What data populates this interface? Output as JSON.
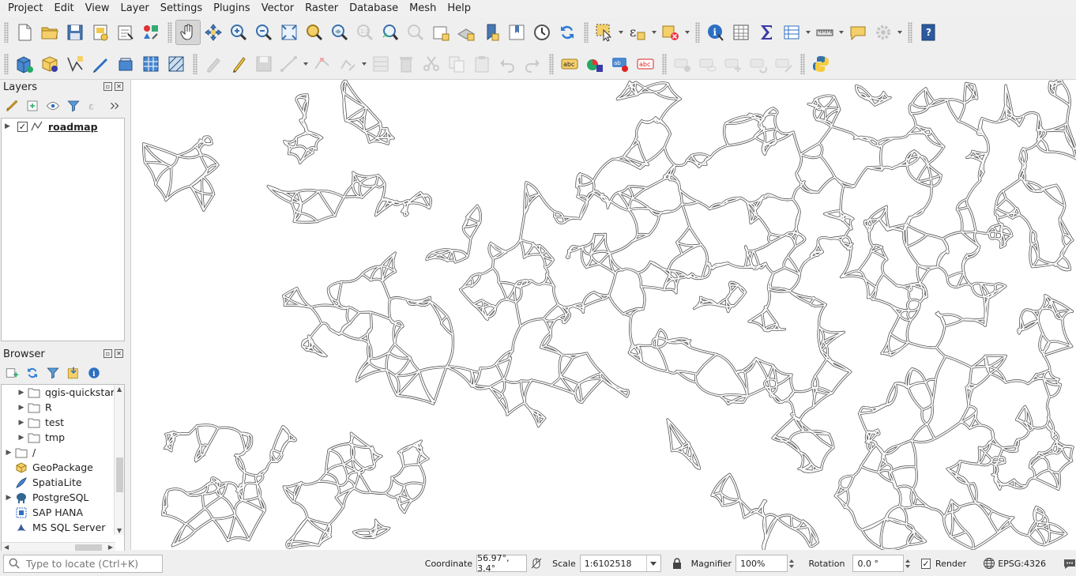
{
  "menu": [
    "Project",
    "Edit",
    "View",
    "Layer",
    "Settings",
    "Plugins",
    "Vector",
    "Raster",
    "Database",
    "Mesh",
    "Help"
  ],
  "layers_panel": {
    "title": "Layers"
  },
  "layers": [
    {
      "name": "roadmap",
      "visible": true
    }
  ],
  "browser_panel": {
    "title": "Browser",
    "items": [
      {
        "label": "qgis-quickstart",
        "icon": "folder-icon",
        "level": 1,
        "expandable": true
      },
      {
        "label": "R",
        "icon": "folder-icon",
        "level": 1,
        "expandable": true
      },
      {
        "label": "test",
        "icon": "folder-icon",
        "level": 1,
        "expandable": true
      },
      {
        "label": "tmp",
        "icon": "folder-icon",
        "level": 1,
        "expandable": true
      },
      {
        "label": "/",
        "icon": "folder-icon",
        "level": 0,
        "expandable": true
      },
      {
        "label": "GeoPackage",
        "icon": "geopackage-icon",
        "level": 0,
        "expandable": false
      },
      {
        "label": "SpatiaLite",
        "icon": "spatialite-icon",
        "level": 0,
        "expandable": false
      },
      {
        "label": "PostgreSQL",
        "icon": "postgresql-icon",
        "level": 0,
        "expandable": true
      },
      {
        "label": "SAP HANA",
        "icon": "sap-hana-icon",
        "level": 0,
        "expandable": false
      },
      {
        "label": "MS SQL Server",
        "icon": "mssql-icon",
        "level": 0,
        "expandable": false
      }
    ]
  },
  "statusbar": {
    "locator_placeholder": "Type to locate (Ctrl+K)",
    "coordinate_label": "Coordinate",
    "coordinate_value": "56.97°, 3.4°",
    "scale_label": "Scale",
    "scale_value": "1:6102518",
    "magnifier_label": "Magnifier",
    "magnifier_value": "100%",
    "rotation_label": "Rotation",
    "rotation_value": "0.0 °",
    "render_label": "Render",
    "crs": "EPSG:4326"
  },
  "colors": {
    "road_casing": "#555555",
    "road_fill": "#ffffff",
    "accent": "#2d7bd6"
  }
}
